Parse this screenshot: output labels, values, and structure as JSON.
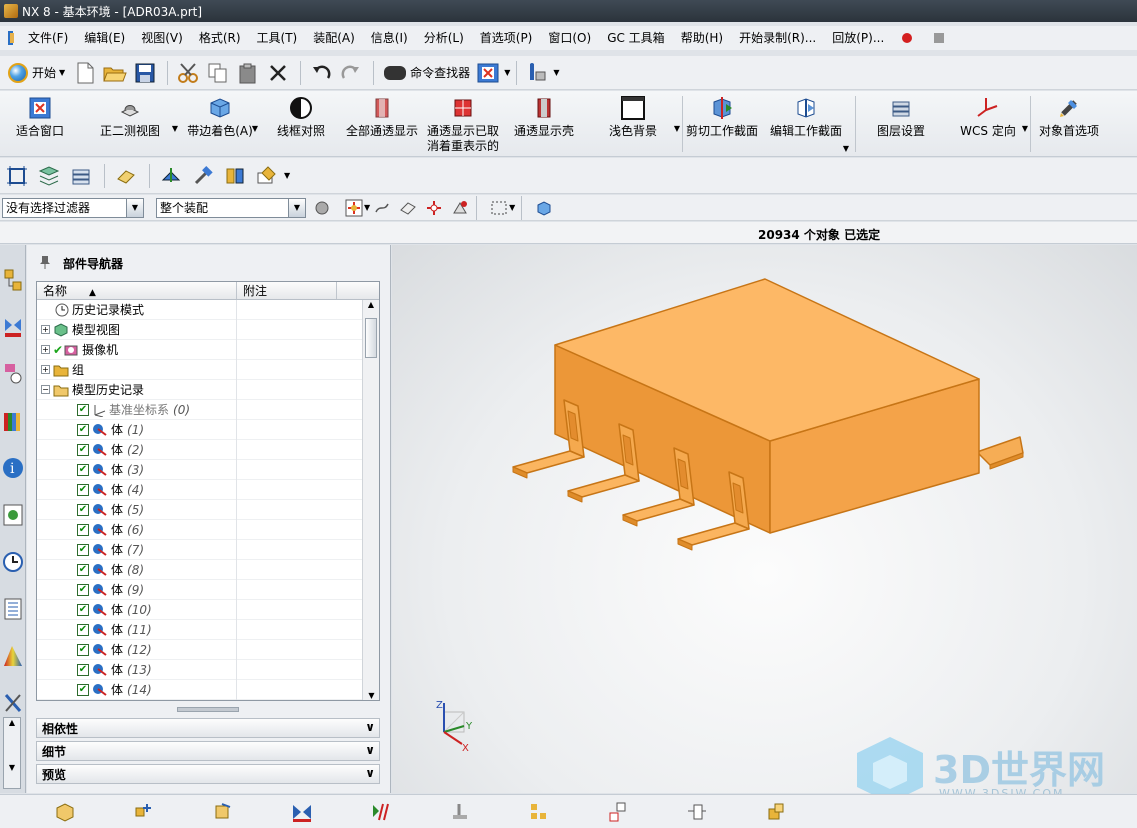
{
  "window": {
    "title": "NX 8 - 基本环境 - [ADR03A.prt]"
  },
  "menubar": {
    "items": [
      "文件(F)",
      "编辑(E)",
      "视图(V)",
      "格式(R)",
      "工具(T)",
      "装配(A)",
      "信息(I)",
      "分析(L)",
      "首选项(P)",
      "窗口(O)",
      "GC 工具箱",
      "帮助(H)",
      "开始录制(R)...",
      "回放(P)..."
    ]
  },
  "toolbar1": {
    "start_label": "开始",
    "command_finder_label": "命令查找器"
  },
  "toolbar2": {
    "buttons": [
      {
        "label": "适合窗口",
        "icon": "fit-icon"
      },
      {
        "label": "正二测视图",
        "icon": "trimetric-view-icon"
      },
      {
        "label": "带边着色(A)",
        "icon": "shaded-edges-icon"
      },
      {
        "label": "线框对照",
        "icon": "wireframe-icon"
      },
      {
        "label": "全部通透显示",
        "icon": "see-through-icon"
      },
      {
        "label": "通透显示已取消着重表示的",
        "icon": "see-through-deemph-icon"
      },
      {
        "label": "通透显示壳",
        "icon": "see-through-shell-icon"
      },
      {
        "label": "浅色背景",
        "icon": "light-background-icon"
      },
      {
        "label": "剪切工作截面",
        "icon": "clip-section-icon"
      },
      {
        "label": "编辑工作截面",
        "icon": "edit-section-icon"
      },
      {
        "label": "图层设置",
        "icon": "layer-settings-icon"
      },
      {
        "label": "WCS 定向",
        "icon": "wcs-orient-icon"
      },
      {
        "label": "对象首选项",
        "icon": "object-preferences-icon"
      }
    ]
  },
  "filterbar": {
    "selection_filter": "没有选择过滤器",
    "scope": "整个装配"
  },
  "status": {
    "text": "20934 个对象 已选定"
  },
  "navigator": {
    "title": "部件导航器",
    "columns": [
      "名称",
      "附注"
    ],
    "rows": [
      {
        "label": "历史记录模式",
        "suffix": "",
        "type": "history-mode",
        "indent": 1
      },
      {
        "label": "模型视图",
        "suffix": "",
        "type": "model-views",
        "indent": 0
      },
      {
        "label": "摄像机",
        "suffix": "",
        "type": "cameras",
        "indent": 0
      },
      {
        "label": "组",
        "suffix": "",
        "type": "groups",
        "indent": 0
      },
      {
        "label": "模型历史记录",
        "suffix": "",
        "type": "model-history",
        "indent": 0
      },
      {
        "label": "基准坐标系",
        "suffix": "(0)",
        "type": "datum",
        "indent": 2
      },
      {
        "label": "体",
        "suffix": "(1)",
        "type": "body",
        "indent": 2
      },
      {
        "label": "体",
        "suffix": "(2)",
        "type": "body",
        "indent": 2
      },
      {
        "label": "体",
        "suffix": "(3)",
        "type": "body",
        "indent": 2
      },
      {
        "label": "体",
        "suffix": "(4)",
        "type": "body",
        "indent": 2
      },
      {
        "label": "体",
        "suffix": "(5)",
        "type": "body",
        "indent": 2
      },
      {
        "label": "体",
        "suffix": "(6)",
        "type": "body",
        "indent": 2
      },
      {
        "label": "体",
        "suffix": "(7)",
        "type": "body",
        "indent": 2
      },
      {
        "label": "体",
        "suffix": "(8)",
        "type": "body",
        "indent": 2
      },
      {
        "label": "体",
        "suffix": "(9)",
        "type": "body",
        "indent": 2
      },
      {
        "label": "体",
        "suffix": "(10)",
        "type": "body",
        "indent": 2
      },
      {
        "label": "体",
        "suffix": "(11)",
        "type": "body",
        "indent": 2
      },
      {
        "label": "体",
        "suffix": "(12)",
        "type": "body",
        "indent": 2
      },
      {
        "label": "体",
        "suffix": "(13)",
        "type": "body",
        "indent": 2
      },
      {
        "label": "体",
        "suffix": "(14)",
        "type": "body",
        "indent": 2
      }
    ],
    "sections": [
      "相依性",
      "细节",
      "预览"
    ]
  },
  "viewport": {
    "model_color": "#f5a94e",
    "triad_labels": {
      "z": "Z",
      "y": "Y",
      "x": "X"
    }
  },
  "watermark": {
    "title": "3D世界网",
    "url": "WWW.3DSJW.COM"
  }
}
